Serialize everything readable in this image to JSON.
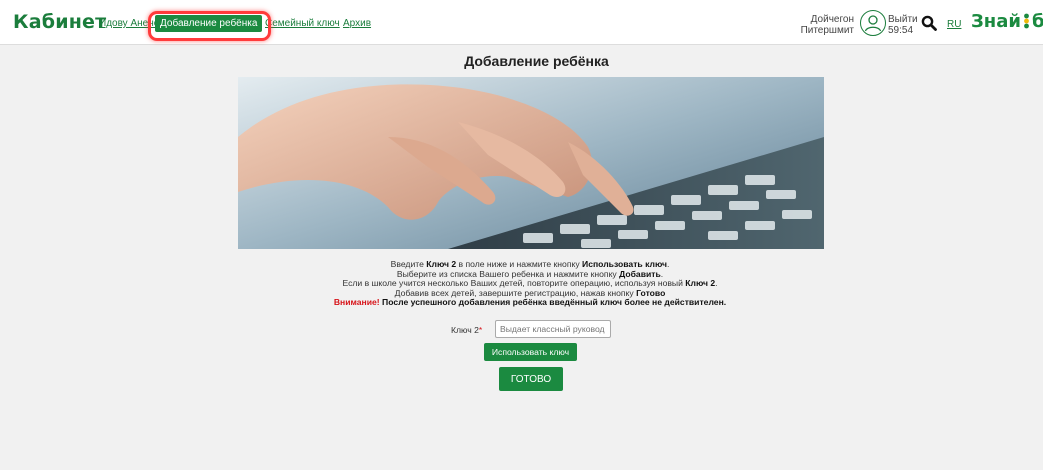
{
  "header": {
    "brand": "Кабинет",
    "nav": [
      {
        "label": "Идову Анене"
      },
      {
        "label": "Добавление ребёнка",
        "active": true
      },
      {
        "label": "Семейный ключ"
      },
      {
        "label": "Архив"
      }
    ],
    "user": {
      "first_name": "Дойчегон",
      "last_name": "Питершмит"
    },
    "logout": {
      "label": "Выйти",
      "timer": "59:54"
    },
    "language": "RU",
    "logo": {
      "part1": "Знай",
      "part2": "бай"
    }
  },
  "page": {
    "title": "Добавление ребёнка",
    "hero_image": "hands-typing-on-keyboard",
    "instructions": {
      "line1": {
        "a": "Введите ",
        "b": "Ключ 2",
        "c": " в поле ниже и нажмите кнопку ",
        "d": "Использовать ключ",
        "e": "."
      },
      "line2": {
        "a": "Выберите из списка Вашего ребенка и нажмите кнопку ",
        "b": "Добавить",
        "c": "."
      },
      "line3": {
        "a": "Если в школе учится несколько Ваших детей, повторите операцию, используя новый ",
        "b": "Ключ 2",
        "c": "."
      },
      "line4": {
        "a": "Добавив всех детей, завершите регистрацию, нажав кнопку ",
        "b": "Готово"
      },
      "warning": {
        "label": "Внимание!",
        "text": " После успешного добавления ребёнка введённый ключ более не действителен."
      }
    },
    "form": {
      "key_label": "Ключ 2",
      "required_mark": "*",
      "key_placeholder": "Выдает классный руковод",
      "key_value": "",
      "use_key_button": "Использовать ключ",
      "done_button": "ГОТОВО"
    }
  },
  "colors": {
    "brand_green": "#1b7d3c",
    "button_green": "#1b8a40",
    "highlight_red": "#ff3b3b",
    "warning_red": "#d7141a"
  },
  "icons": {
    "search": "search-icon",
    "avatar": "user-avatar-icon"
  }
}
